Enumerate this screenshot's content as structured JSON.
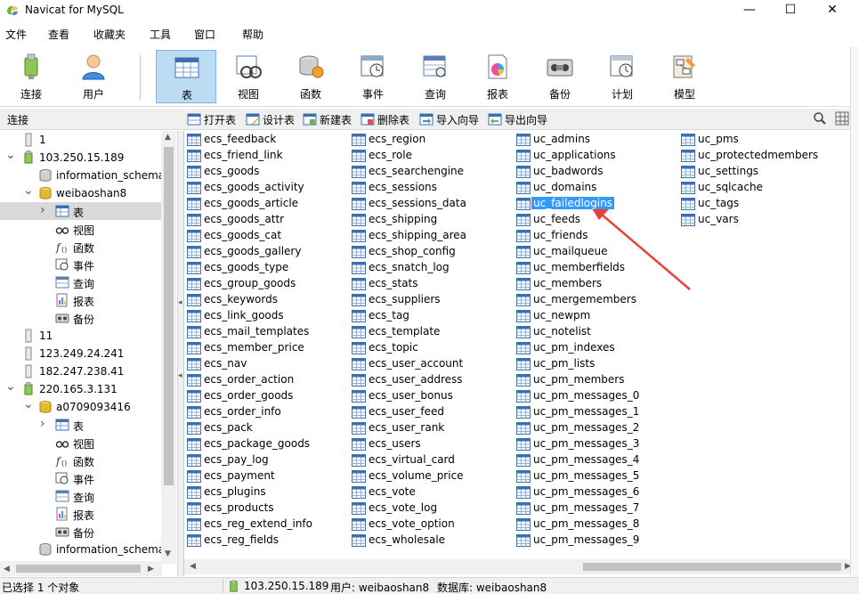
{
  "window": {
    "title": "Navicat for MySQL",
    "controls": [
      "—",
      "☐",
      "✕"
    ]
  },
  "menu": [
    "文件",
    "查看",
    "收藏夹",
    "工具",
    "窗口",
    "帮助"
  ],
  "toolbar": [
    {
      "label": "连接",
      "icon": "connection-icon"
    },
    {
      "label": "用户",
      "icon": "user-icon"
    },
    {
      "label": "表",
      "icon": "table-icon",
      "active": true
    },
    {
      "label": "视图",
      "icon": "view-icon"
    },
    {
      "label": "函数",
      "icon": "function-icon"
    },
    {
      "label": "事件",
      "icon": "event-icon"
    },
    {
      "label": "查询",
      "icon": "query-icon"
    },
    {
      "label": "报表",
      "icon": "report-icon"
    },
    {
      "label": "备份",
      "icon": "backup-icon"
    },
    {
      "label": "计划",
      "icon": "schedule-icon"
    },
    {
      "label": "模型",
      "icon": "model-icon"
    }
  ],
  "subbar": {
    "connection_label": "连接",
    "actions": [
      "打开表",
      "设计表",
      "新建表",
      "删除表",
      "导入向导",
      "导出向导"
    ]
  },
  "tree": [
    {
      "label": "1",
      "level": 0,
      "icon": "server-icon",
      "expander": ""
    },
    {
      "label": "103.250.15.189",
      "level": 0,
      "icon": "server-connected-icon",
      "expander": "v"
    },
    {
      "label": "information_schema",
      "level": 1,
      "icon": "database-icon",
      "expander": ""
    },
    {
      "label": "weibaoshan8",
      "level": 1,
      "icon": "database-open-icon",
      "expander": "v"
    },
    {
      "label": "表",
      "level": 2,
      "icon": "table-icon",
      "expander": ">",
      "selected": true
    },
    {
      "label": "视图",
      "level": 2,
      "icon": "view-icon",
      "expander": ""
    },
    {
      "label": "函数",
      "level": 2,
      "icon": "function-icon",
      "expander": ""
    },
    {
      "label": "事件",
      "level": 2,
      "icon": "event-icon",
      "expander": ""
    },
    {
      "label": "查询",
      "level": 2,
      "icon": "query-icon",
      "expander": ""
    },
    {
      "label": "报表",
      "level": 2,
      "icon": "report-icon",
      "expander": ""
    },
    {
      "label": "备份",
      "level": 2,
      "icon": "backup-icon",
      "expander": ""
    },
    {
      "label": "11",
      "level": 0,
      "icon": "server-icon",
      "expander": ""
    },
    {
      "label": "123.249.24.241",
      "level": 0,
      "icon": "server-icon",
      "expander": ""
    },
    {
      "label": "182.247.238.41",
      "level": 0,
      "icon": "server-icon",
      "expander": ""
    },
    {
      "label": "220.165.3.131",
      "level": 0,
      "icon": "server-connected-icon",
      "expander": "v"
    },
    {
      "label": "a0709093416",
      "level": 1,
      "icon": "database-open-icon",
      "expander": "v"
    },
    {
      "label": "表",
      "level": 2,
      "icon": "table-icon",
      "expander": ">"
    },
    {
      "label": "视图",
      "level": 2,
      "icon": "view-icon",
      "expander": ""
    },
    {
      "label": "函数",
      "level": 2,
      "icon": "function-icon",
      "expander": ""
    },
    {
      "label": "事件",
      "level": 2,
      "icon": "event-icon",
      "expander": ""
    },
    {
      "label": "查询",
      "level": 2,
      "icon": "query-icon",
      "expander": ""
    },
    {
      "label": "报表",
      "level": 2,
      "icon": "report-icon",
      "expander": ""
    },
    {
      "label": "备份",
      "level": 2,
      "icon": "backup-icon",
      "expander": ""
    },
    {
      "label": "information_schema",
      "level": 1,
      "icon": "database-icon",
      "expander": ""
    }
  ],
  "tables": {
    "columns": [
      [
        "ecs_feedback",
        "ecs_friend_link",
        "ecs_goods",
        "ecs_goods_activity",
        "ecs_goods_article",
        "ecs_goods_attr",
        "ecs_goods_cat",
        "ecs_goods_gallery",
        "ecs_goods_type",
        "ecs_group_goods",
        "ecs_keywords",
        "ecs_link_goods",
        "ecs_mail_templates",
        "ecs_member_price",
        "ecs_nav",
        "ecs_order_action",
        "ecs_order_goods",
        "ecs_order_info",
        "ecs_pack",
        "ecs_package_goods",
        "ecs_pay_log",
        "ecs_payment",
        "ecs_plugins",
        "ecs_products",
        "ecs_reg_extend_info",
        "ecs_reg_fields"
      ],
      [
        "ecs_region",
        "ecs_role",
        "ecs_searchengine",
        "ecs_sessions",
        "ecs_sessions_data",
        "ecs_shipping",
        "ecs_shipping_area",
        "ecs_shop_config",
        "ecs_snatch_log",
        "ecs_stats",
        "ecs_suppliers",
        "ecs_tag",
        "ecs_template",
        "ecs_topic",
        "ecs_user_account",
        "ecs_user_address",
        "ecs_user_bonus",
        "ecs_user_feed",
        "ecs_user_rank",
        "ecs_users",
        "ecs_virtual_card",
        "ecs_volume_price",
        "ecs_vote",
        "ecs_vote_log",
        "ecs_vote_option",
        "ecs_wholesale"
      ],
      [
        "uc_admins",
        "uc_applications",
        "uc_badwords",
        "uc_domains",
        "uc_failedlogins",
        "uc_feeds",
        "uc_friends",
        "uc_mailqueue",
        "uc_memberfields",
        "uc_members",
        "uc_mergemembers",
        "uc_newpm",
        "uc_notelist",
        "uc_pm_indexes",
        "uc_pm_lists",
        "uc_pm_members",
        "uc_pm_messages_0",
        "uc_pm_messages_1",
        "uc_pm_messages_2",
        "uc_pm_messages_3",
        "uc_pm_messages_4",
        "uc_pm_messages_5",
        "uc_pm_messages_6",
        "uc_pm_messages_7",
        "uc_pm_messages_8",
        "uc_pm_messages_9"
      ],
      [
        "uc_pms",
        "uc_protectedmembers",
        "uc_settings",
        "uc_sqlcache",
        "uc_tags",
        "uc_vars"
      ]
    ],
    "selected": "uc_failedlogins"
  },
  "status": {
    "selection": "已选择 1 个对象",
    "server": "103.250.15.189",
    "user": "用户: weibaoshan8",
    "database": "数据库: weibaoshan8"
  },
  "colors": {
    "selection": "#3399ff",
    "toolbar_active": "#bcdcf4",
    "annotation_arrow": "#e8413c"
  }
}
